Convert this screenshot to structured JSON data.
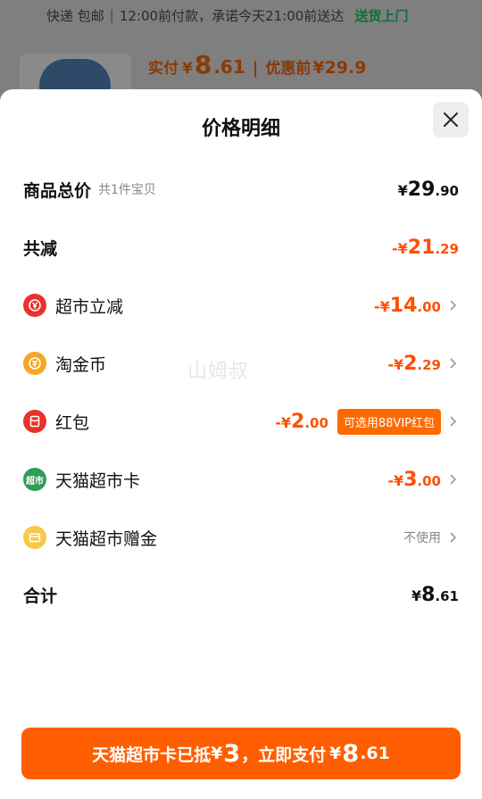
{
  "background": {
    "delivery": "快递 包邮",
    "promise": "12:00前付款，承诺今天21:00前送达",
    "home_delivery": "送货上门",
    "paid_label": "实付",
    "currency": "¥",
    "paid_int": "8",
    "paid_dec": ".61",
    "before_label": "优惠前",
    "before_price": "¥29.9"
  },
  "sheet": {
    "title": "价格明细",
    "total": {
      "label": "商品总价",
      "sub": "共1件宝贝",
      "pre": "¥",
      "int": "29",
      "dec": ".90"
    },
    "reduced": {
      "label": "共减",
      "pre": "-¥",
      "int": "21",
      "dec": ".29"
    },
    "items": [
      {
        "label": "超市立减",
        "pre": "-¥",
        "int": "14",
        "dec": ".00"
      },
      {
        "label": "淘金币",
        "pre": "-¥",
        "int": "2",
        "dec": ".29"
      },
      {
        "label": "红包",
        "pre": "-¥",
        "int": "2",
        "dec": ".00",
        "badge": "可选用88VIP红包"
      },
      {
        "label": "天猫超市卡",
        "pre": "-¥",
        "int": "3",
        "dec": ".00",
        "icon_text": "超市"
      },
      {
        "label": "天猫超市赠金",
        "status": "不使用"
      }
    ],
    "sum": {
      "label": "合计",
      "pre": "¥",
      "int": "8",
      "dec": ".61"
    },
    "watermark": "山姆叔"
  },
  "pay_button": {
    "text1": "天猫超市卡已抵",
    "cur1": "¥",
    "int1": "3",
    "text2": "，立即支付",
    "cur2": "¥",
    "int2": "8",
    "dec2": ".61"
  },
  "colors": {
    "accent": "#ff5000",
    "badge": "#ff6a00",
    "button": "#ff5e00",
    "icon_red": "#e8322b",
    "icon_gold": "#f5a623",
    "icon_green": "#2e9e55",
    "icon_yellow": "#f8c84a"
  },
  "icons": {
    "close": "close-icon",
    "chevron": "chevron-right-icon",
    "supermarket_discount": "yuan-coin-icon",
    "taojinbi": "gold-coin-icon",
    "red_packet": "red-packet-icon",
    "tmall_card": "supermarket-card-icon",
    "bonus": "gift-card-icon"
  }
}
